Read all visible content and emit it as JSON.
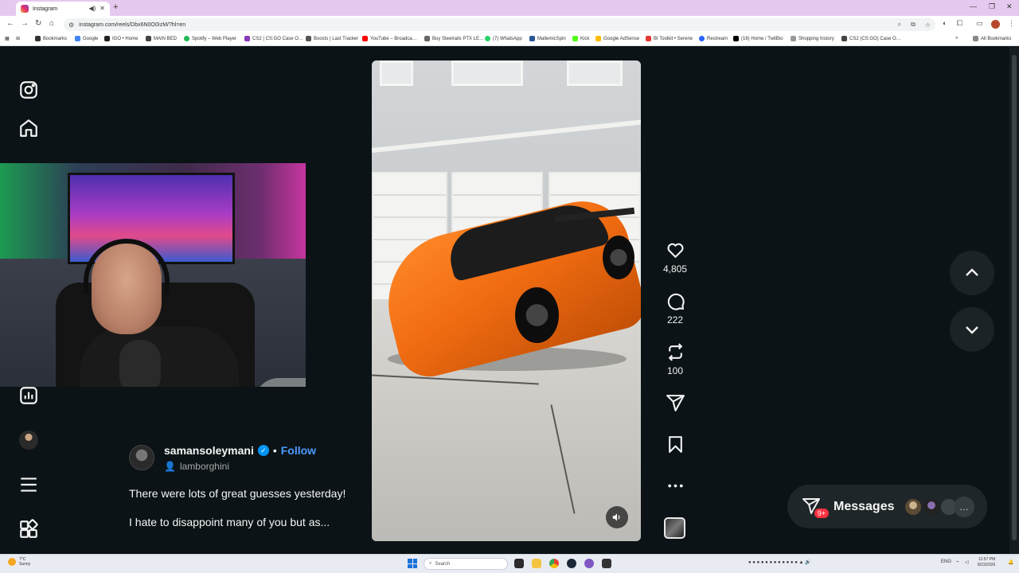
{
  "browser": {
    "tab_title": "Instagram",
    "url": "instagram.com/reels/Dbx6N0O0IzM/?hl=en",
    "bookmarks": [
      "Bookmarks",
      "Google",
      "IGO • Home",
      "MAIN BED",
      "Spotify – Web Player",
      "CS2 | CS:GO Case O…",
      "Boosts | Last Tracker",
      "YouTube – Broadca…",
      "Buy Steelrails PTX LE…",
      "(7) WhatsApp",
      "MallemicSpin",
      "Kick",
      "Google AdSense",
      "BI Toolkit • Serene",
      "Restream",
      "(16) Home / TwitBio",
      "Shopping history",
      "CS2 (CS:GO) Case O…"
    ],
    "all_bookmarks": "All Bookmarks"
  },
  "reel": {
    "username": "samansoleymani",
    "separator": "•",
    "follow_label": "Follow",
    "audio": "lamborghini",
    "caption_line1": "There were lots of great guesses yesterday!",
    "caption_line2": "I hate to disappoint many of you but as...",
    "likes": "4,805",
    "comments": "222",
    "reposts": "100"
  },
  "messages": {
    "label": "Messages",
    "badge": "9+",
    "more": "…"
  },
  "taskbar": {
    "weather_temp": "7°C",
    "weather_desc": "Sunny",
    "search_placeholder": "Search",
    "lang": "ENG",
    "time": "11:57 PM",
    "date": "8/23/2026"
  },
  "colors": {
    "page_bg": "#0b1316",
    "follow_blue": "#4c9bff",
    "badge_red": "#ff3040",
    "verified_blue": "#0095f6"
  }
}
